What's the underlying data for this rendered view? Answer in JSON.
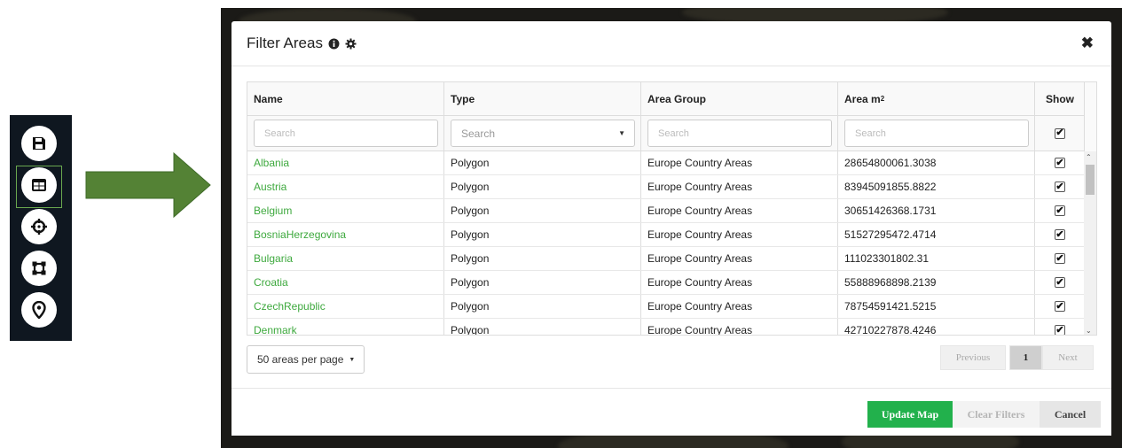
{
  "toolbar": {
    "buttons": [
      {
        "icon": "save-icon"
      },
      {
        "icon": "table-icon",
        "selected": true
      },
      {
        "icon": "crosshair-icon"
      },
      {
        "icon": "polygon-icon"
      },
      {
        "icon": "map-pin-icon"
      }
    ],
    "accent_color": "#6aa84f"
  },
  "arrow": {
    "color": "#548235"
  },
  "modal": {
    "title": "Filter Areas",
    "title_icons": [
      "info-icon",
      "gear-icon"
    ],
    "close_icon": "close-icon",
    "table": {
      "columns": {
        "name": "Name",
        "type": "Type",
        "area_group": "Area Group",
        "area": "Area m",
        "area_sup": "2",
        "show": "Show"
      },
      "filters": {
        "name_placeholder": "Search",
        "type_value": "Search",
        "area_group_placeholder": "Search",
        "area_placeholder": "Search",
        "show_checked": true
      },
      "rows": [
        {
          "name": "Albania",
          "type": "Polygon",
          "group": "Europe Country Areas",
          "area": "28654800061.3038",
          "show": true
        },
        {
          "name": "Austria",
          "type": "Polygon",
          "group": "Europe Country Areas",
          "area": "83945091855.8822",
          "show": true
        },
        {
          "name": "Belgium",
          "type": "Polygon",
          "group": "Europe Country Areas",
          "area": "30651426368.1731",
          "show": true
        },
        {
          "name": "BosniaHerzegovina",
          "type": "Polygon",
          "group": "Europe Country Areas",
          "area": "51527295472.4714",
          "show": true
        },
        {
          "name": "Bulgaria",
          "type": "Polygon",
          "group": "Europe Country Areas",
          "area": "111023301802.31",
          "show": true
        },
        {
          "name": "Croatia",
          "type": "Polygon",
          "group": "Europe Country Areas",
          "area": "55888968898.2139",
          "show": true
        },
        {
          "name": "CzechRepublic",
          "type": "Polygon",
          "group": "Europe Country Areas",
          "area": "78754591421.5215",
          "show": true
        },
        {
          "name": "Denmark",
          "type": "Polygon",
          "group": "Europe Country Areas",
          "area": "42710227878.4246",
          "show": true
        }
      ]
    },
    "per_page": "50 areas per page",
    "pagination": {
      "previous": "Previous",
      "current": "1",
      "next": "Next"
    },
    "footer": {
      "update": "Update Map",
      "clear": "Clear Filters",
      "cancel": "Cancel"
    },
    "colors": {
      "name_link": "#3ea93e",
      "primary_button": "#22b14c"
    }
  }
}
